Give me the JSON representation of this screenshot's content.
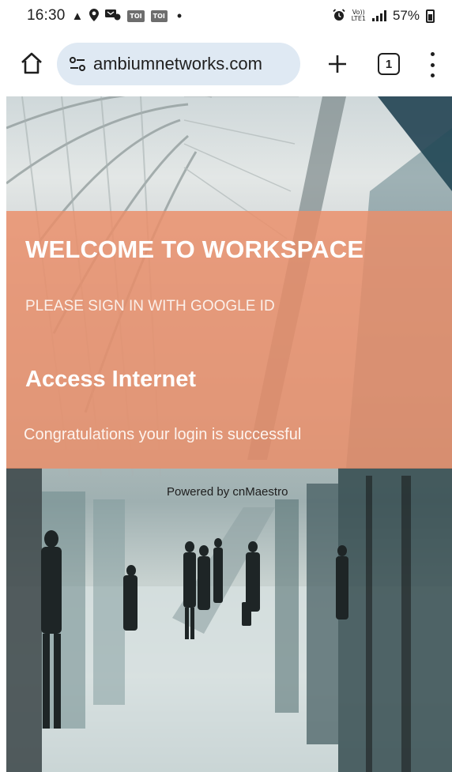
{
  "status_bar": {
    "time": "16:30",
    "notifications": [
      "warning-icon",
      "location-icon",
      "sms-icon",
      "toi-icon",
      "toi-icon"
    ],
    "toi_label": "TOI",
    "dot": "•",
    "volte_top": "Vo))",
    "volte_bottom": "LTE1",
    "battery_percent": "57%"
  },
  "browser": {
    "url": "ambiumnetworks.com",
    "tab_count": "1"
  },
  "page": {
    "welcome_title": "WELCOME TO WORKSPACE",
    "welcome_subtitle": "PLEASE SIGN IN WITH GOOGLE ID",
    "access_title": "Access Internet",
    "status_message": "Congratulations your login is successful",
    "powered_by": "Powered by cnMaestro"
  },
  "colors": {
    "overlay": "#EC8D68",
    "address_bar": "#DFE9F3",
    "text_dark": "#1F1F1F"
  }
}
